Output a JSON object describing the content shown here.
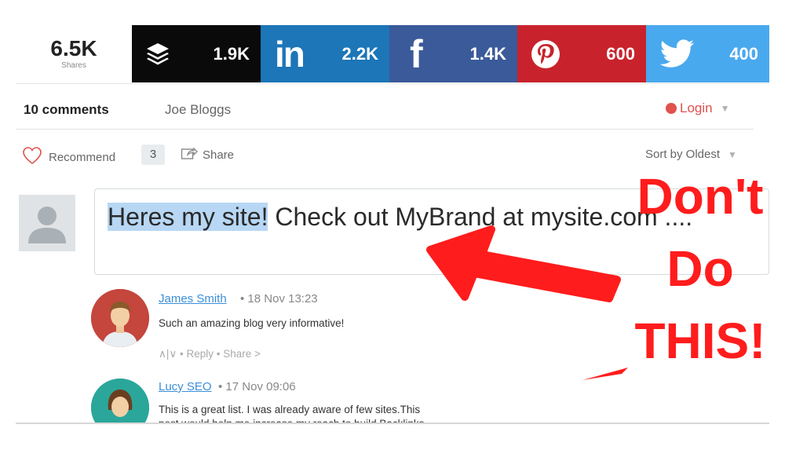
{
  "share_bar": {
    "total_count": "6.5K",
    "total_label": "Shares",
    "services": [
      {
        "name": "buffer",
        "count": "1.9K",
        "color": "#0a0a0a"
      },
      {
        "name": "linkedin",
        "count": "2.2K",
        "color": "#1c76b7",
        "glyph": "in"
      },
      {
        "name": "facebook",
        "count": "1.4K",
        "color": "#3b5a9a",
        "glyph": "f"
      },
      {
        "name": "pinterest",
        "count": "600",
        "color": "#c8232c"
      },
      {
        "name": "twitter",
        "count": "400",
        "color": "#49a9ee"
      }
    ]
  },
  "comments_header": {
    "count_label": "10 comments",
    "user": "Joe Bloggs",
    "login_label": "Login"
  },
  "actions": {
    "recommend_label": "Recommend",
    "vote_count": "3",
    "share_label": "Share",
    "sort_label": "Sort by Oldest"
  },
  "composer": {
    "highlighted_text": "Heres my site!",
    "text_rest": " Check out MyBrand at mysite.com ...."
  },
  "comments": [
    {
      "author": "James Smith",
      "meta": "• 18 Nov 13:23",
      "text": "Such an amazing blog very informative!",
      "footer": "∧|∨ • Reply • Share >"
    },
    {
      "author": "Lucy SEO",
      "meta": "• 17 Nov 09:06",
      "text": "This is a great list. I was already aware of few sites.This",
      "text_line2": "post would help me increase my reach to build Backlinks"
    }
  ],
  "overlay": {
    "line1": "Don't",
    "line2": "Do",
    "line3": "THIS!",
    "color": "#ff1c1c"
  }
}
